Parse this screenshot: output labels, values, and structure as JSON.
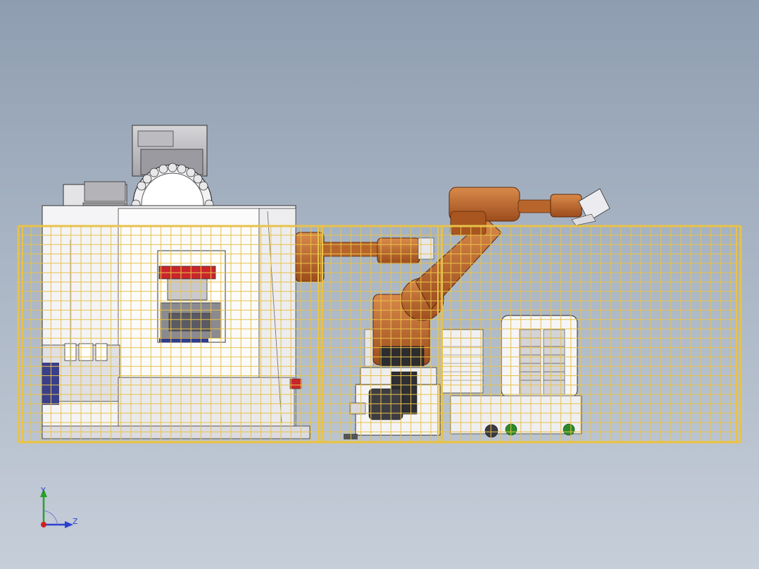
{
  "scene": {
    "background_top": "#8e9db0",
    "background_bottom": "#c6ced9",
    "fence_color": "#e8c24a",
    "robot_color": "#c86a2c",
    "machine_color": "#f4f4f6"
  },
  "triad": {
    "y_label": "Y",
    "z_label": "Z",
    "icon": "coordinate-triad-icon"
  }
}
